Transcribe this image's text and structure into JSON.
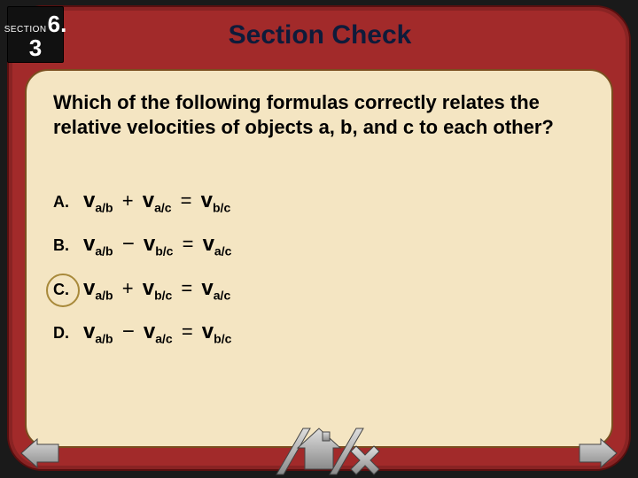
{
  "section": {
    "label": "SECTION",
    "chapter": "6.",
    "sub": "3"
  },
  "title": "Section Check",
  "question": "Which of the following formulas correctly relates the relative velocities of objects a, b, and c to each other?",
  "options": [
    {
      "letter": "A.",
      "t1_sub": "a/b",
      "op": "+",
      "t2_sub": "a/c",
      "t3_sub": "b/c",
      "circled": false
    },
    {
      "letter": "B.",
      "t1_sub": "a/b",
      "op": "−",
      "t2_sub": "b/c",
      "t3_sub": "a/c",
      "circled": false
    },
    {
      "letter": "C.",
      "t1_sub": "a/b",
      "op": "+",
      "t2_sub": "b/c",
      "t3_sub": "a/c",
      "circled": true
    },
    {
      "letter": "D.",
      "t1_sub": "a/b",
      "op": "−",
      "t2_sub": "a/c",
      "t3_sub": "b/c",
      "circled": false
    }
  ],
  "formula": {
    "variable": "v",
    "eq": "="
  }
}
